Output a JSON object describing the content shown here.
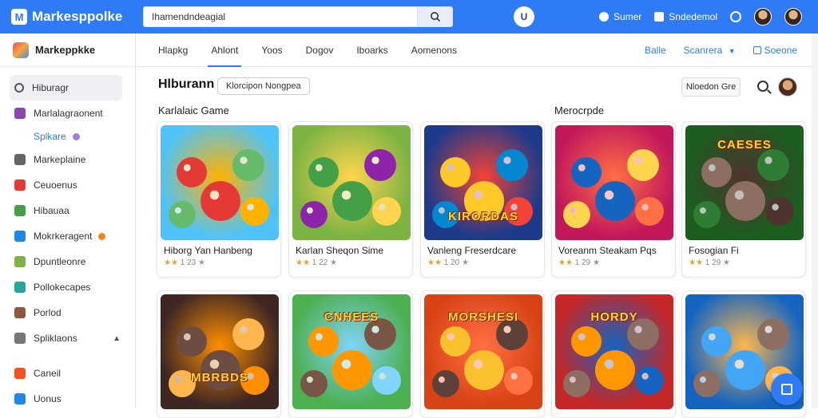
{
  "app": {
    "title": "Markesppolke"
  },
  "search": {
    "value": "Ihamendndeagial",
    "icon": "search-icon"
  },
  "topbar": {
    "center_logo": "U",
    "item1": "Sumer",
    "item2": "Sndedemol"
  },
  "sidebar": {
    "brand": "Markeppkke",
    "items": [
      {
        "label": "Hiburagr",
        "color": "#555555",
        "active": true
      },
      {
        "label": "Marlalagraonent",
        "color": "#8e44ad"
      },
      {
        "label": "Splkare",
        "color": "#9b7ee0",
        "sub": true
      },
      {
        "label": "Markeplaine",
        "color": "#666666"
      },
      {
        "label": "Ceuoenus",
        "color": "#e53935"
      },
      {
        "label": "Hibauaa",
        "color": "#43a047"
      },
      {
        "label": "Mokrkeragent",
        "color": "#1e88e5",
        "badge": "#f5811f"
      },
      {
        "label": "Dpuntleonre",
        "color": "#7cb342"
      },
      {
        "label": "Pollokecapes",
        "color": "#26a69a"
      },
      {
        "label": "Porlod",
        "color": "#8d5b3c"
      },
      {
        "label": "Spliklaons",
        "color": "#777777",
        "chevron": "chevron-up-icon"
      },
      {
        "label": "Caneil",
        "color": "#f4511e"
      },
      {
        "label": "Uonus",
        "color": "#1e88e5"
      }
    ]
  },
  "tabs": [
    "Hlapkg",
    "Ahlont",
    "Yoos",
    "Dogov",
    "Iboarks",
    "Aomenons"
  ],
  "tabs_right": {
    "link1": "Balle",
    "link2": "Scanrera"
  },
  "main": {
    "title": "Hlburann",
    "pill": "Klorcipon Nongpea",
    "sort": "Nloedon Gre",
    "section1": "Karlalaic Game",
    "section2": "Merocrpde"
  },
  "cards_row1": [
    {
      "name": "Hiborg Yan Hanbeng",
      "rating": "23"
    },
    {
      "name": "Karlan Sheqon Sime",
      "rating": "22"
    },
    {
      "name": "Vanleng Freserdcare",
      "rating": "20"
    },
    {
      "name": "Voreanm Steakam Pqs",
      "rating": "29"
    },
    {
      "name": "Fosogian Fi",
      "rating": "29"
    }
  ],
  "cards_row2": [
    {
      "banner": "MBRBDS"
    },
    {
      "banner": "CNHEES"
    },
    {
      "banner": "MORSHESI"
    },
    {
      "banner": "HORDY"
    },
    {
      "banner": ""
    }
  ],
  "art_banners": {
    "card3": "KIRORDAS",
    "card5": "CAESES"
  }
}
